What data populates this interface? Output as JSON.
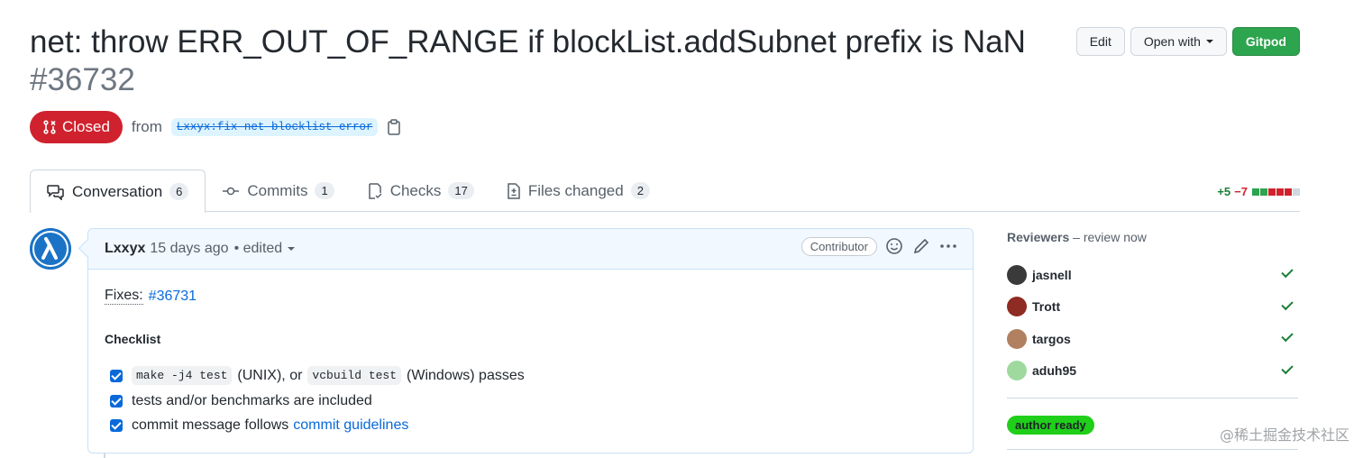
{
  "pr": {
    "title": "net: throw ERR_OUT_OF_RANGE if blockList.addSubnet prefix is NaN",
    "number": "#36732",
    "state": "Closed",
    "from_text": "from",
    "branch": "Lxxyx:fix-net-blocklist-error"
  },
  "actions": {
    "edit": "Edit",
    "open_with": "Open with",
    "gitpod": "Gitpod"
  },
  "tabs": [
    {
      "label": "Conversation",
      "count": "6",
      "icon": "comment-discussion-icon"
    },
    {
      "label": "Commits",
      "count": "1",
      "icon": "git-commit-icon"
    },
    {
      "label": "Checks",
      "count": "17",
      "icon": "checklist-icon"
    },
    {
      "label": "Files changed",
      "count": "2",
      "icon": "file-diff-icon"
    }
  ],
  "diffstat": {
    "additions": "+5",
    "deletions": "−7",
    "colors": [
      "#2da44e",
      "#2da44e",
      "#cf222e",
      "#cf222e",
      "#cf222e",
      "#d0d7de"
    ]
  },
  "comment": {
    "author": "Lxxyx",
    "time": "15 days ago",
    "edited": "• edited",
    "badge": "Contributor",
    "fixes_label": "Fixes:",
    "fixes_link": "#36731",
    "checklist_title": "Checklist",
    "tasks": [
      {
        "code1": "make -j4 test",
        "text1": "(UNIX), or",
        "code2": "vcbuild test",
        "text2": "(Windows) passes"
      },
      {
        "text": "tests and/or benchmarks are included"
      },
      {
        "text": "commit message follows",
        "link": "commit guidelines"
      }
    ]
  },
  "sidebar": {
    "reviewers_title": "Reviewers",
    "reviewers_sub": "– review now",
    "reviewers": [
      {
        "name": "jasnell",
        "color": "#3a3a3a"
      },
      {
        "name": "Trott",
        "color": "#8e2b22"
      },
      {
        "name": "targos",
        "color": "#b08060"
      },
      {
        "name": "aduh95",
        "color": "#9ed99e"
      }
    ],
    "label": "author ready",
    "label_color": "#1fcf1a"
  },
  "watermark": "@稀土掘金技术社区"
}
